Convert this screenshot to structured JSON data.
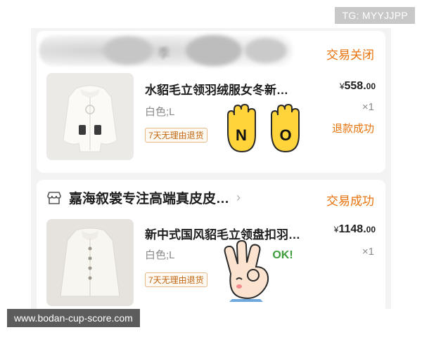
{
  "watermark_top": "TG: MYYJJPP",
  "watermark_bottom": "www.bodan-cup-score.com",
  "order1": {
    "store_blurred_char": "季",
    "status": "交易关闭",
    "title": "水貂毛立领羽绒服女冬新…",
    "spec": "白色;L",
    "tag": "7天无理由退货",
    "price_symbol": "¥",
    "price_int": "558.",
    "price_dec": "00",
    "qty": "×1",
    "refund_status": "退款成功"
  },
  "order2": {
    "store_name": "嘉海叙裳专注高端真皮皮…",
    "chevron": "›",
    "status": "交易成功",
    "title": "新中式国风貂毛立领盘扣羽…",
    "spec": "白色;L",
    "tag": "7天无理由退货",
    "price_symbol": "¥",
    "price_int": "1148.",
    "price_dec": "00",
    "qty": "×1"
  },
  "stickers": {
    "no_letters": [
      "N",
      "O"
    ],
    "ok_text": "OK!"
  },
  "colors": {
    "accent": "#e8720c",
    "text": "#1e1e1e",
    "muted": "#8a8a8a"
  }
}
